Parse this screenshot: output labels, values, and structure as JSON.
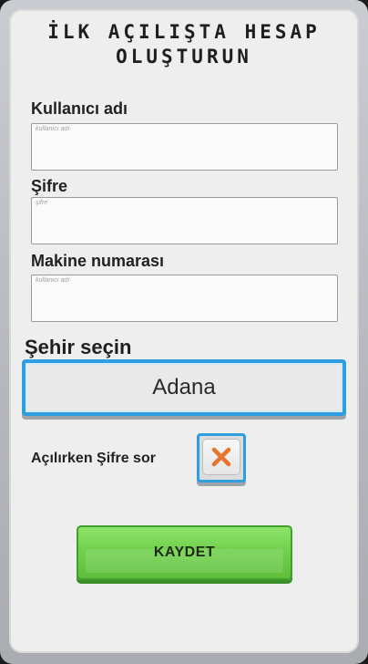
{
  "title": {
    "line1": "İLK AÇILIŞTA HESAP",
    "line2": "OLUŞTURUN"
  },
  "form": {
    "username": {
      "label": "Kullanıcı adı",
      "placeholder": "kullanıcı adı",
      "value": ""
    },
    "password": {
      "label": "Şifre",
      "placeholder": "şifre",
      "value": ""
    },
    "machine_number": {
      "label": "Makine numarası",
      "placeholder": "kullanıcı adı",
      "value": ""
    },
    "city": {
      "label": "Şehir seçin",
      "selected": "Adana"
    },
    "ask_password": {
      "label": "Açılırken Şifre sor",
      "checked": false,
      "icon": "close-icon"
    }
  },
  "actions": {
    "save_label": "KAYDET"
  },
  "colors": {
    "accent_blue": "#2d9fe0",
    "save_green": "#71d04c",
    "x_orange": "#e8742a",
    "panel_bg": "#eeeeee"
  }
}
